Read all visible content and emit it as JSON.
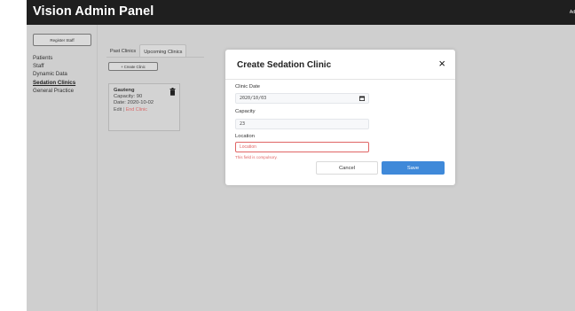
{
  "header": {
    "title": "Vision Admin Panel",
    "user": "Ad"
  },
  "sidebar": {
    "register_label": "Register Staff",
    "items": [
      {
        "label": "Patients"
      },
      {
        "label": "Staff"
      },
      {
        "label": "Dynamic Data"
      },
      {
        "label": "Sedation Clinics"
      },
      {
        "label": "General Practice"
      }
    ],
    "active": "Sedation Clinics"
  },
  "main": {
    "tabs": [
      {
        "label": "Past Clinics"
      },
      {
        "label": "Upcoming Clinics"
      }
    ],
    "active_tab": "Upcoming Clinics",
    "create_label": "+ Create Clinic",
    "clinic": {
      "name": "Gauteng",
      "capacity": "Capacity: 90",
      "date": "Date: 2020-10-02",
      "edit_label": "Edit",
      "separator": "|",
      "end_label": "End Clinic"
    }
  },
  "modal": {
    "title": "Create Sedation Clinic",
    "close": "×",
    "date_label": "Clinic Date",
    "date_value": "2020/10/03",
    "capacity_label": "Capacity",
    "capacity_value": "23",
    "location_label": "Location",
    "location_placeholder": "Location",
    "error": "This field is compulsory.",
    "cancel_label": "Cancel",
    "save_label": "Save"
  },
  "colors": {
    "topbar": "#1f1f1f",
    "background": "#cfcfcf",
    "primary": "#3f89d9",
    "error": "#e06565"
  }
}
